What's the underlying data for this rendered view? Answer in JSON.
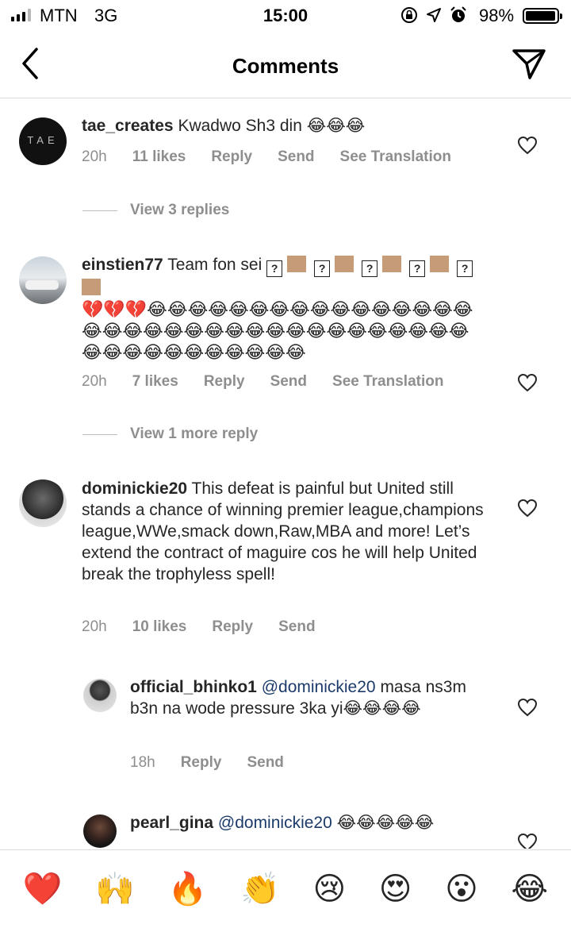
{
  "status": {
    "carrier": "MTN",
    "network": "3G",
    "time": "15:00",
    "battery": "98%",
    "battery_level": 0.98,
    "icons": [
      "orientation-lock-icon",
      "location-icon",
      "alarm-icon"
    ]
  },
  "header": {
    "title": "Comments",
    "back_icon": "chevron-left-icon",
    "dm_icon": "paper-plane-icon"
  },
  "comments": [
    {
      "username": "tae_creates",
      "text": "Kwadwo Sh3 din 😂😂😂",
      "avatar_text": "TAE",
      "time": "20h",
      "likes": "11 likes",
      "reply": "Reply",
      "send": "Send",
      "translate": "See Translation",
      "view_replies": "View 3 replies"
    },
    {
      "username": "einstien77",
      "text_prefix": "Team fon sei",
      "text_emojis": "💔💔💔😂😂😂😂😂😂😂😂😂😂😂😂😂😂😂😂😂😂😂😂😂😂😂😂😂😂😂😂😂😂😂😂😂😂😂😂😂😂😂😂😂😂😂😂😂😂",
      "unknown_glyph": "?",
      "time": "20h",
      "likes": "7 likes",
      "reply": "Reply",
      "send": "Send",
      "translate": "See Translation",
      "view_replies": "View 1 more reply"
    },
    {
      "username": "dominickie20",
      "text": "This defeat is painful but United still stands a chance of winning premier league,champions league,WWe,smack down,Raw,MBA and more! Let’s extend the contract of maguire cos he will help United break the trophyless spell!",
      "time": "20h",
      "likes": "10 likes",
      "reply": "Reply",
      "send": "Send"
    },
    {
      "username": "official_bhinko1",
      "mention": "@dominickie20",
      "text": "masa ns3m b3n na wode pressure 3ka yi😂😂😂😂",
      "time": "18h",
      "reply": "Reply",
      "send": "Send"
    },
    {
      "username": "pearl_gina",
      "mention": "@dominickie20",
      "text": "😂😂😂😂😂"
    }
  ],
  "reactions": [
    "❤️",
    "🙌",
    "🔥",
    "👏",
    "😢",
    "😍",
    "😮",
    "😂"
  ],
  "colors": {
    "text": "#262626",
    "meta": "#8e8e8e",
    "mention": "#1c3b6a",
    "divider": "#dbdbdb"
  }
}
